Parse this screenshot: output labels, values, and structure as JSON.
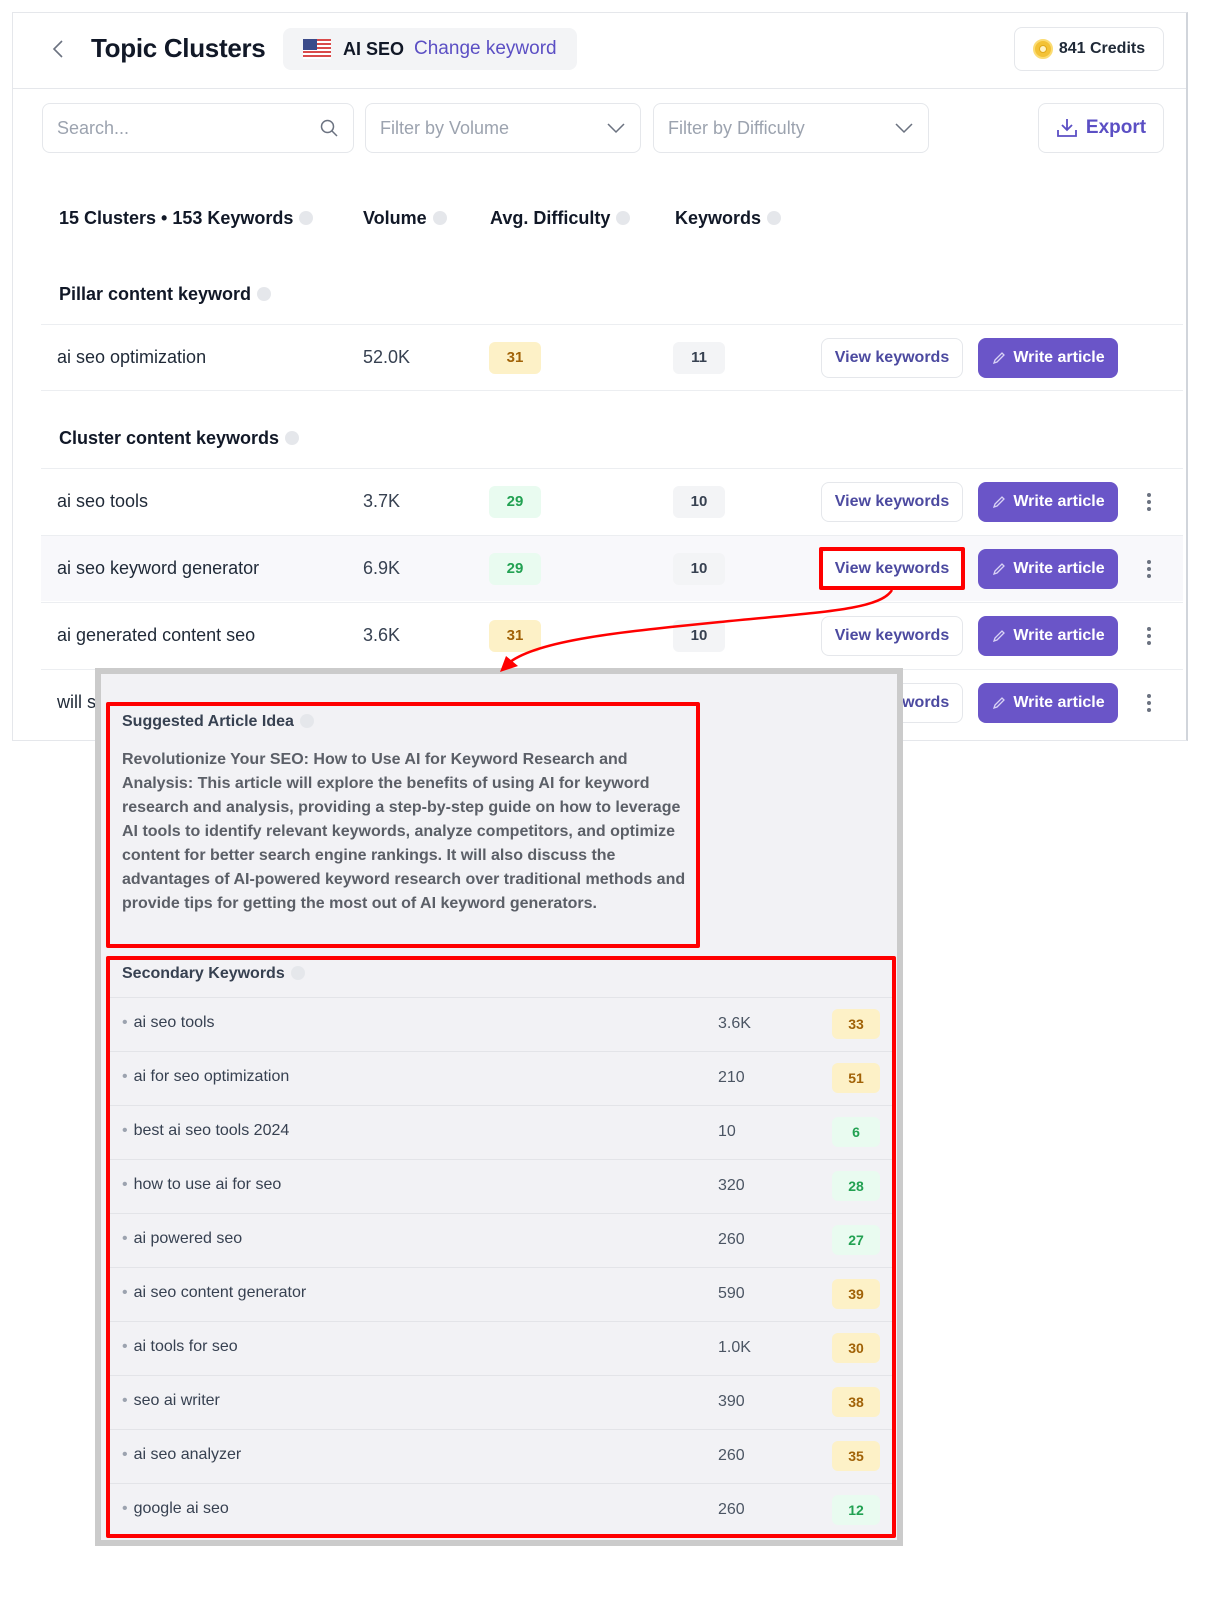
{
  "header": {
    "back_icon": "chevron-left-icon",
    "title": "Topic Clusters",
    "keyword_flag": "us-flag-icon",
    "keyword": "AI SEO",
    "change_keyword_label": "Change keyword",
    "credits_icon": "coin-icon",
    "credits": "841 Credits"
  },
  "toolbar": {
    "search_placeholder": "Search...",
    "filter_volume_placeholder": "Filter by Volume",
    "filter_difficulty_placeholder": "Filter by Difficulty",
    "export_label": "Export"
  },
  "columns": {
    "summary": "15 Clusters • 153 Keywords",
    "volume": "Volume",
    "difficulty": "Avg. Difficulty",
    "keywords": "Keywords"
  },
  "pillar": {
    "label": "Pillar content keyword",
    "rows": [
      {
        "name": "ai seo optimization",
        "volume": "52.0K",
        "difficulty": "31",
        "difficulty_level": "medium",
        "keywords": "11"
      }
    ]
  },
  "cluster": {
    "label": "Cluster content keywords",
    "rows": [
      {
        "name": "ai seo tools",
        "volume": "3.7K",
        "difficulty": "29",
        "difficulty_level": "easy",
        "keywords": "10"
      },
      {
        "name": "ai seo keyword generator",
        "volume": "6.9K",
        "difficulty": "29",
        "difficulty_level": "easy",
        "keywords": "10"
      },
      {
        "name": "ai generated content seo",
        "volume": "3.6K",
        "difficulty": "31",
        "difficulty_level": "medium",
        "keywords": "10"
      },
      {
        "name": "will s"
      }
    ]
  },
  "actions": {
    "view_keywords_label": "View keywords",
    "write_article_label": "Write article"
  },
  "popup": {
    "suggested_title": "Suggested Article Idea",
    "suggested_text": "Revolutionize Your SEO: How to Use AI for Keyword Research and Analysis: This article will explore the benefits of using AI for keyword research and analysis, providing a step-by-step guide on how to leverage AI tools to identify relevant keywords, analyze competitors, and optimize content for better search engine rankings. It will also discuss the advantages of AI-powered keyword research over traditional methods and provide tips for getting the most out of AI keyword generators.",
    "secondary_title": "Secondary Keywords",
    "secondary_keywords": [
      {
        "keyword": "ai seo tools",
        "volume": "3.6K",
        "difficulty": "33",
        "level": "medium"
      },
      {
        "keyword": "ai for seo optimization",
        "volume": "210",
        "difficulty": "51",
        "level": "medium"
      },
      {
        "keyword": "best ai seo tools 2024",
        "volume": "10",
        "difficulty": "6",
        "level": "easy"
      },
      {
        "keyword": "how to use ai for seo",
        "volume": "320",
        "difficulty": "28",
        "level": "easy"
      },
      {
        "keyword": "ai powered seo",
        "volume": "260",
        "difficulty": "27",
        "level": "easy"
      },
      {
        "keyword": "ai seo content generator",
        "volume": "590",
        "difficulty": "39",
        "level": "medium"
      },
      {
        "keyword": "ai tools for seo",
        "volume": "1.0K",
        "difficulty": "30",
        "level": "medium"
      },
      {
        "keyword": "seo ai writer",
        "volume": "390",
        "difficulty": "38",
        "level": "medium"
      },
      {
        "keyword": "ai seo analyzer",
        "volume": "260",
        "difficulty": "35",
        "level": "medium"
      },
      {
        "keyword": "google ai seo",
        "volume": "260",
        "difficulty": "12",
        "level": "easy"
      }
    ]
  },
  "colors": {
    "accent": "#6a55c8",
    "link": "#5b4fc4",
    "annotation": "#ff0000",
    "difficulty_easy_bg": "#e9fbf0",
    "difficulty_easy_fg": "#22a152",
    "difficulty_medium_bg": "#fdf1c7",
    "difficulty_medium_fg": "#a16207"
  }
}
